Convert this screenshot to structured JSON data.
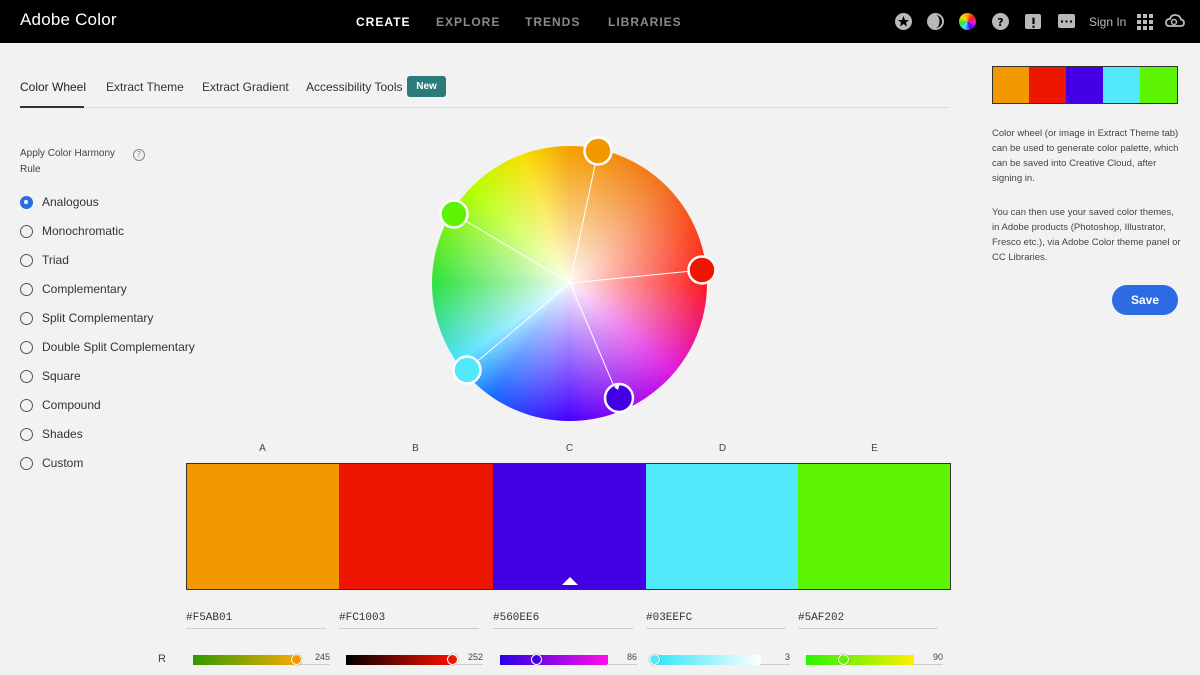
{
  "app": {
    "title": "Adobe Color",
    "nav": [
      "CREATE",
      "EXPLORE",
      "TRENDS",
      "LIBRARIES"
    ],
    "active_nav": "CREATE",
    "sign_in": "Sign In",
    "icons": [
      "star-icon",
      "moon-icon",
      "color-wheel-icon",
      "help-icon",
      "feedback-icon",
      "chat-icon",
      "apps-grid-icon",
      "creative-cloud-icon"
    ]
  },
  "tabs": {
    "items": [
      "Color Wheel",
      "Extract Theme",
      "Extract Gradient",
      "Accessibility Tools"
    ],
    "active": "Color Wheel",
    "new_badge": "New"
  },
  "harmony": {
    "title": "Apply Color Harmony Rule",
    "help": "?",
    "rules": [
      "Analogous",
      "Monochromatic",
      "Triad",
      "Complementary",
      "Split Complementary",
      "Double Split Complementary",
      "Square",
      "Compound",
      "Shades",
      "Custom"
    ],
    "selected": "Analogous"
  },
  "swatches": [
    {
      "letter": "A",
      "hex": "#F5AB01",
      "color": "#F29900",
      "r": "245",
      "r_fraction": 0.96
    },
    {
      "letter": "B",
      "hex": "#FC1003",
      "color": "#EE1600",
      "r": "252",
      "r_fraction": 0.99
    },
    {
      "letter": "C",
      "hex": "#560EE6",
      "color": "#4300E4",
      "r": "86",
      "r_fraction": 0.34
    },
    {
      "letter": "D",
      "hex": "#03EEFC",
      "color": "#52E9FA",
      "r": "3",
      "r_fraction": 0.01
    },
    {
      "letter": "E",
      "hex": "#5AF202",
      "color": "#5CF400",
      "r": "90",
      "r_fraction": 0.35
    }
  ],
  "base_swatch": "C",
  "channel_label": "R",
  "panel": {
    "text1": "Color wheel (or image in Extract Theme tab) can be used to generate color palette, which can be saved into Creative Cloud, after signing in.",
    "text2": "You can then use your saved color themes, in Adobe products (Photoshop, Illustrator, Fresco etc.), via Adobe Color theme panel or CC Libraries.",
    "save": "Save"
  }
}
